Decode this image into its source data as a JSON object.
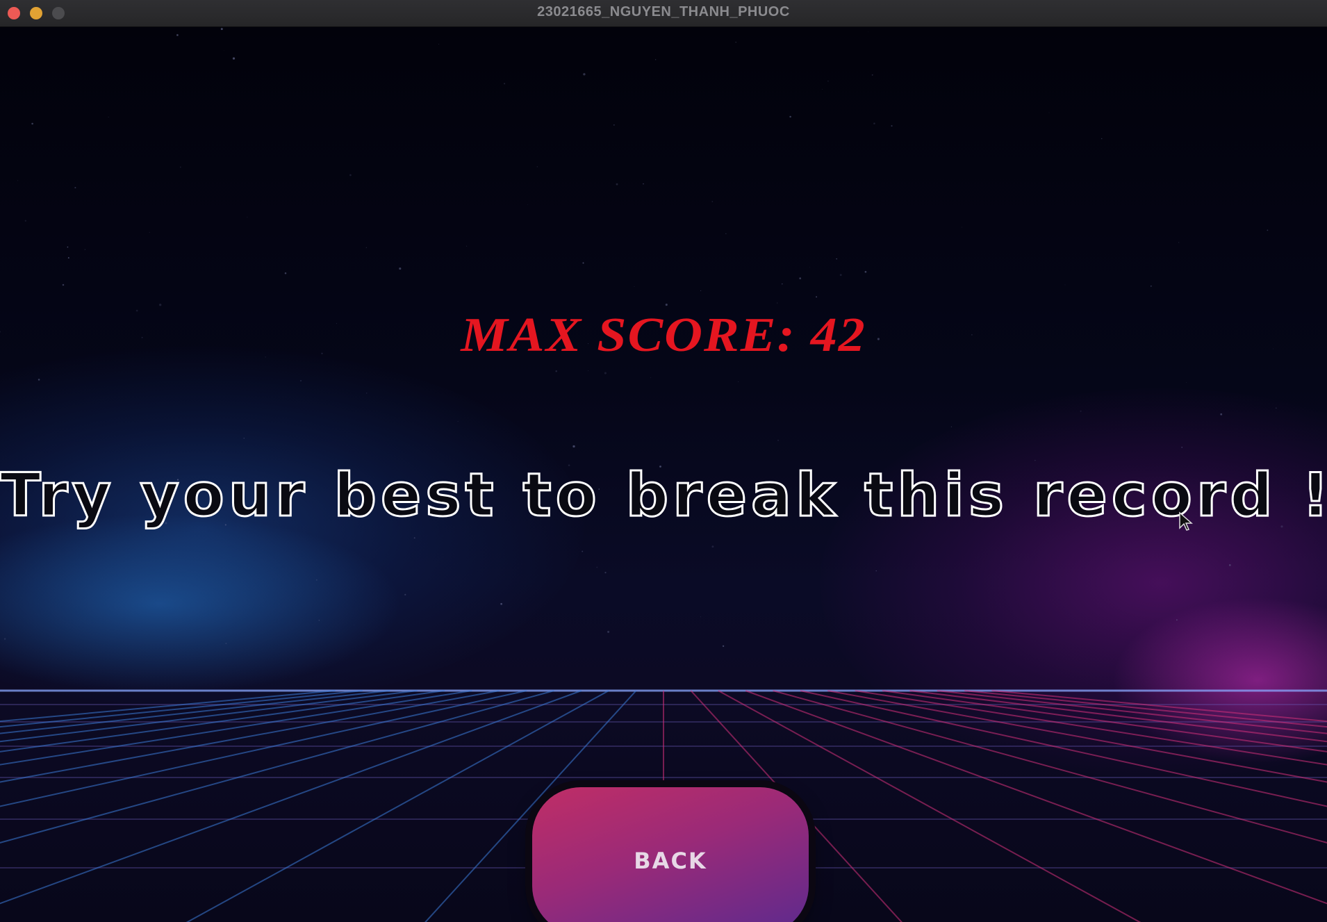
{
  "window": {
    "title": "23021665_NGUYEN_THANH_PHUOC"
  },
  "game": {
    "max_score_label": "MAX SCORE: 42",
    "max_score_value": 42,
    "message": "Try your best to break this record !",
    "back_button_label": "BACK"
  },
  "colors": {
    "score_text": "#e51620",
    "message_fill": "#0a0a12",
    "message_outline": "#ffffff",
    "button_gradient_start": "#c02e66",
    "button_gradient_end": "#5c2a8e",
    "grid_blue": "#3b7bd8",
    "grid_pink": "#d2307a"
  }
}
